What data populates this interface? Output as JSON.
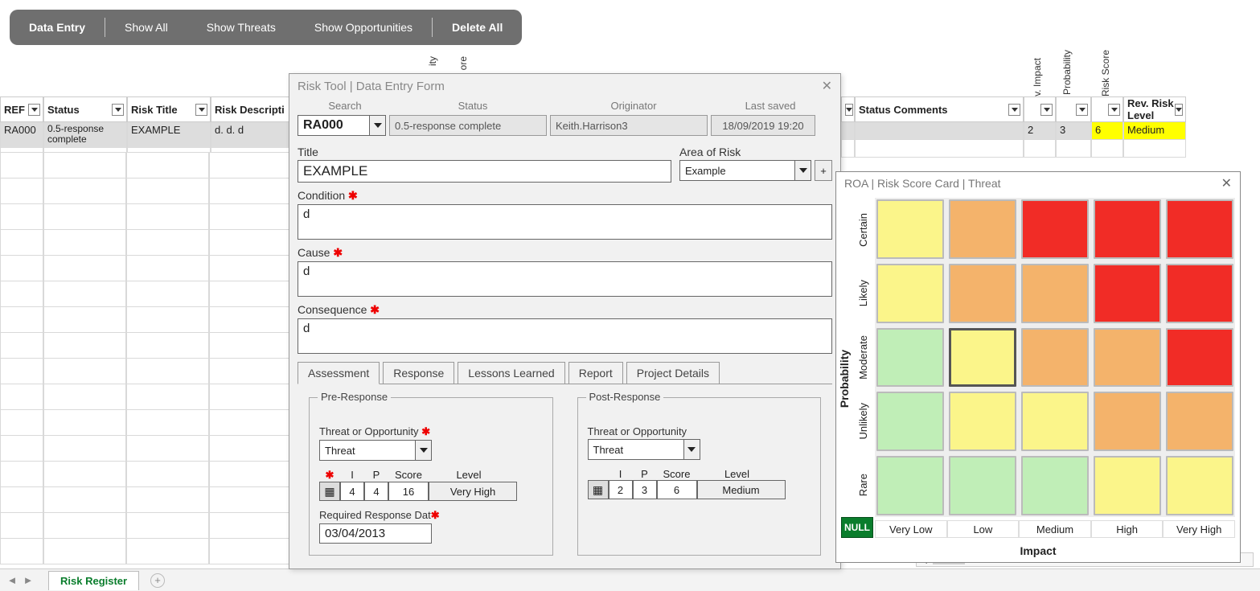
{
  "topbar": {
    "data_entry": "Data Entry",
    "show_all": "Show All",
    "show_threats": "Show Threats",
    "show_opps": "Show Opportunities",
    "delete_all": "Delete All"
  },
  "vheaders": {
    "ity": "ity",
    "ore": "ore",
    "rev_impact": "Rev. Impact",
    "rev_prob": "Rev. Probability",
    "rev_score": "Rev. Risk Score"
  },
  "sheet": {
    "headers": [
      "REF",
      "Status",
      "Risk Title",
      "Risk Descripti",
      "Status Comments",
      "Rev. Risk Level"
    ],
    "row": {
      "ref": "RA000",
      "status": "0.5-response complete",
      "title": "EXAMPLE",
      "desc": "d.  d.  d",
      "rev_impact": "2",
      "rev_prob": "3",
      "rev_score": "6",
      "rev_level": "Medium"
    }
  },
  "modal": {
    "title": "Risk Tool | Data Entry Form",
    "search_label": "Search",
    "status_label": "Status",
    "orig_label": "Originator",
    "saved_label": "Last saved",
    "search_value": "RA000",
    "status_value": "0.5-response complete",
    "orig_value": "Keith.Harrison3",
    "saved_value": "18/09/2019 19:20",
    "title_label": "Title",
    "title_value": "EXAMPLE",
    "area_label": "Area of Risk",
    "area_value": "Example",
    "plus": "+",
    "cond_label": "Condition",
    "cond_value": "d",
    "cause_label": "Cause",
    "cause_value": "d",
    "cons_label": "Consequence",
    "cons_value": "d",
    "tabs": [
      "Assessment",
      "Response",
      "Lessons Learned",
      "Report",
      "Project Details"
    ],
    "pre": {
      "legend": "Pre-Response",
      "to_label": "Threat or Opportunity",
      "to_value": "Threat",
      "i": "4",
      "p": "4",
      "score": "16",
      "level": "Very High"
    },
    "post": {
      "legend": "Post-Response",
      "to_label": "Threat or Opportunity",
      "to_value": "Threat",
      "i": "2",
      "p": "3",
      "score": "6",
      "level": "Medium"
    },
    "iph": {
      "i": "I",
      "p": "P",
      "score": "Score",
      "level": "Level"
    },
    "rrd_label": "Required Response Dat",
    "rrd_value": "03/04/2013",
    "reqmark": "✱"
  },
  "scorecard": {
    "title": "ROA | Risk Score Card | Threat",
    "ylabel": "Probability",
    "xlabel": "Impact",
    "ylabs": [
      "Certain",
      "Likely",
      "Moderate",
      "Unlikely",
      "Rare"
    ],
    "xlabs": [
      "Very Low",
      "Low",
      "Medium",
      "High",
      "Very High"
    ],
    "null": "NULL"
  },
  "footer": {
    "tab": "Risk Register"
  },
  "colors": {
    "yellow": "#ffff00",
    "medium": "#ffff00"
  }
}
